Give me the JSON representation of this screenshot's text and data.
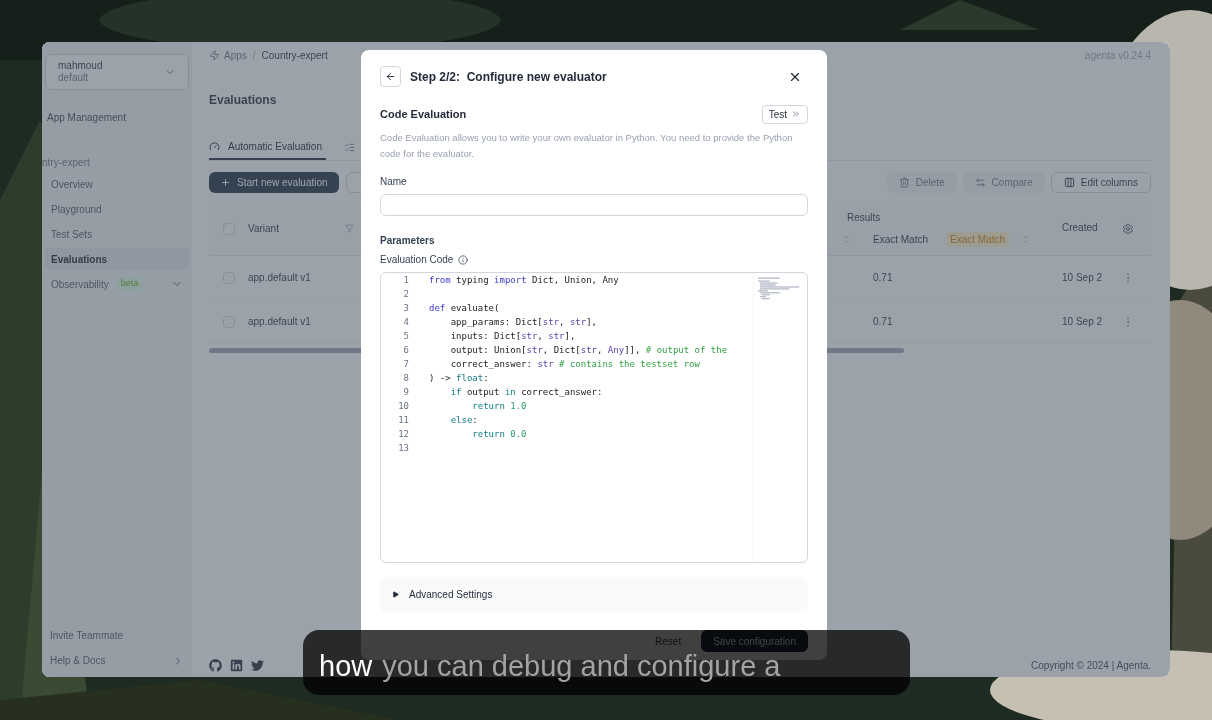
{
  "window": {
    "version": "agenta v0.24.4",
    "breadcrumb": {
      "items": [
        "Apps",
        "Country-expert"
      ],
      "separator": "/"
    },
    "page_title": "Evaluations"
  },
  "sidebar": {
    "account": {
      "name": "mahmoud",
      "workspace": "default"
    },
    "section": "App Management",
    "app": "ntry-expert",
    "items": [
      {
        "label": "Overview",
        "selected": false
      },
      {
        "label": "Playground",
        "selected": false
      },
      {
        "label": "Test Sets",
        "selected": false
      },
      {
        "label": "Evaluations",
        "selected": true
      },
      {
        "label": "Observability",
        "selected": false,
        "badge": "beta"
      }
    ],
    "bottom_items": [
      {
        "label": "Invite Teammate"
      },
      {
        "label": "Help & Docs"
      }
    ]
  },
  "tabs": [
    {
      "label": "Automatic Evaluation",
      "selected": true
    },
    {
      "selected": false
    }
  ],
  "primary_button": "Start new evaluation",
  "toolbar": [
    {
      "label": "Delete",
      "disabled": true
    },
    {
      "label": "Compare",
      "disabled": true
    },
    {
      "label": "Edit columns",
      "disabled": false
    }
  ],
  "table": {
    "header_checked": false,
    "group_header": "Results",
    "columns": {
      "variant": "Variant",
      "metric": "Exact Match",
      "metric_tag": "Exact Match",
      "created": "Created"
    },
    "rows": [
      {
        "checked": false,
        "variant": "app.default v1",
        "score": "0.71",
        "created": "10 Sep 2"
      },
      {
        "checked": false,
        "variant": "app.default v1",
        "score": "0.71",
        "created": "10 Sep 2"
      }
    ]
  },
  "footer": {
    "copyright": "Copyright © 2024 | Agenta."
  },
  "modal": {
    "title": "Step 2/2:  Configure new evaluator",
    "section_title": "Code Evaluation",
    "test_button": "Test",
    "description": "Code Evaluation allows you to write your own evaluator in Python. You need to provide the Python code for the evaluator.",
    "name_label": "Name",
    "parameters_label": "Parameters",
    "code_label": "Evaluation Code",
    "code_lines": [
      {
        "number": "1",
        "tokens": [
          {
            "t": "from",
            "kind": "keyword"
          },
          {
            "t": " typing ",
            "kind": "plain"
          },
          {
            "t": "import",
            "kind": "keyword"
          },
          {
            "t": " Dict, Union, Any",
            "kind": "plain"
          }
        ]
      },
      {
        "number": "2"
      },
      {
        "number": "3",
        "tokens": [
          {
            "t": "def",
            "kind": "keyword"
          },
          {
            "t": " evaluate(",
            "kind": "plain"
          }
        ]
      },
      {
        "number": "4",
        "tokens": [
          {
            "t": "    app_params: Dict[",
            "kind": "plain"
          },
          {
            "t": "str",
            "kind": "type"
          },
          {
            "t": ", ",
            "kind": "plain"
          },
          {
            "t": "str",
            "kind": "type"
          },
          {
            "t": "],",
            "kind": "plain"
          }
        ]
      },
      {
        "number": "5",
        "tokens": [
          {
            "t": "    inputs: Dict[",
            "kind": "plain"
          },
          {
            "t": "str",
            "kind": "type"
          },
          {
            "t": ", ",
            "kind": "plain"
          },
          {
            "t": "str",
            "kind": "type"
          },
          {
            "t": "],",
            "kind": "plain"
          }
        ]
      },
      {
        "number": "6",
        "tokens": [
          {
            "t": "    output: Union[",
            "kind": "plain"
          },
          {
            "t": "str",
            "kind": "type"
          },
          {
            "t": ", Dict[",
            "kind": "plain"
          },
          {
            "t": "str",
            "kind": "type"
          },
          {
            "t": ", ",
            "kind": "plain"
          },
          {
            "t": "Any",
            "kind": "type"
          },
          {
            "t": "]], ",
            "kind": "plain"
          },
          {
            "t": "# output of the",
            "kind": "comment"
          }
        ]
      },
      {
        "number": "7",
        "tokens": [
          {
            "t": "    correct_answer: ",
            "kind": "plain"
          },
          {
            "t": "str",
            "kind": "type"
          },
          {
            "t": " # contains the testset row",
            "kind": "comment"
          }
        ]
      },
      {
        "number": "8",
        "tokens": [
          {
            "t": ") -> ",
            "kind": "plain"
          },
          {
            "t": "float",
            "kind": "control"
          },
          {
            "t": ":",
            "kind": "plain"
          }
        ]
      },
      {
        "number": "9",
        "tokens": [
          {
            "t": "    if",
            "kind": "control"
          },
          {
            "t": " output ",
            "kind": "plain"
          },
          {
            "t": "in",
            "kind": "control"
          },
          {
            "t": " correct_answer:",
            "kind": "plain"
          }
        ]
      },
      {
        "number": "10",
        "tokens": [
          {
            "t": "        return",
            "kind": "control"
          },
          {
            "t": " 1.0",
            "kind": "number"
          }
        ]
      },
      {
        "number": "11",
        "tokens": [
          {
            "t": "    else",
            "kind": "control"
          },
          {
            "t": ":",
            "kind": "plain"
          }
        ]
      },
      {
        "number": "12",
        "tokens": [
          {
            "t": "        return",
            "kind": "control"
          },
          {
            "t": " 0.0",
            "kind": "number"
          }
        ]
      },
      {
        "number": "13"
      }
    ],
    "advanced": {
      "label": "Advanced Settings",
      "expanded": false
    },
    "reset_button": "Reset",
    "save_button": "Save configuration"
  },
  "caption": {
    "words": [
      {
        "text": "how",
        "spoken": true
      },
      {
        "text": "you can debug and configure a",
        "spoken": false
      }
    ]
  }
}
